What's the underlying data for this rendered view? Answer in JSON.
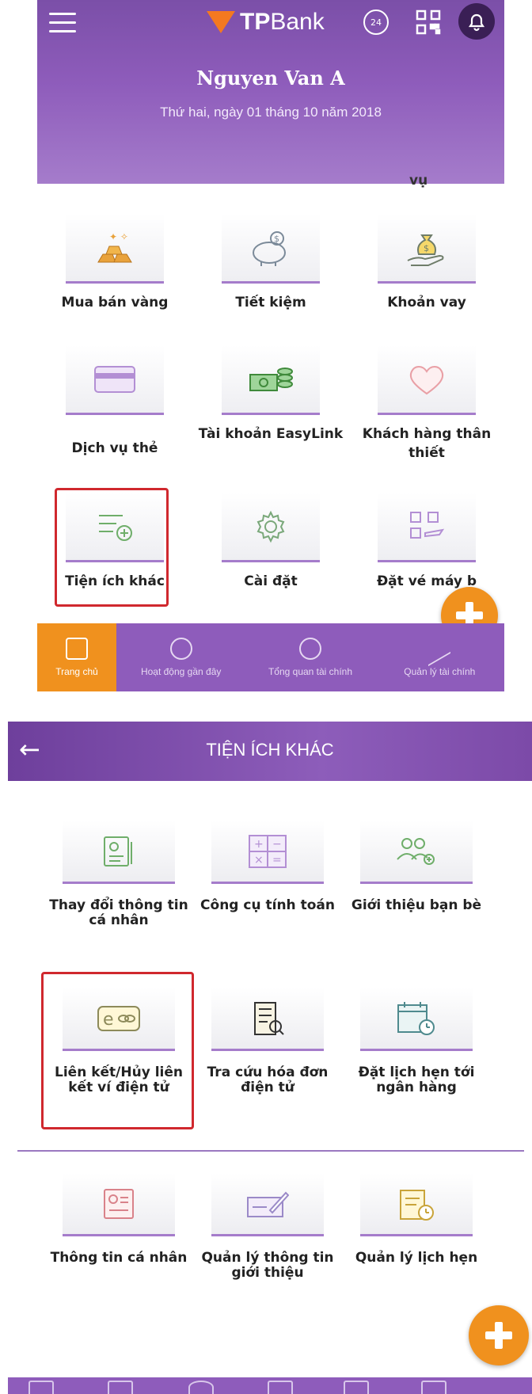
{
  "screen1": {
    "header": {
      "brand_prefix": "TP",
      "brand_suffix": "Bank",
      "user_name": "Nguyen Van A",
      "date": "Thứ hai, ngày 01 tháng 10 năm 2018",
      "hotline_badge": "24"
    },
    "cut_text": "vụ",
    "tiles": [
      {
        "label": "Mua bán vàng",
        "icon": "gold-bars-icon"
      },
      {
        "label": "Tiết kiệm",
        "icon": "piggy-bank-icon"
      },
      {
        "label": "Khoản vay",
        "icon": "money-bag-hand-icon"
      },
      {
        "label": "Dịch vụ thẻ",
        "icon": "card-icon"
      },
      {
        "label": "Tài khoản EasyLink",
        "icon": "coins-banknote-icon"
      },
      {
        "label": "Khách hàng thân thiết",
        "icon": "heart-icon"
      },
      {
        "label": "Tiện ích khác",
        "icon": "list-plus-icon"
      },
      {
        "label": "Cài đặt",
        "icon": "gear-icon"
      },
      {
        "label": "Đặt vé máy b",
        "icon": "plane-qr-icon"
      }
    ],
    "bottom_nav": [
      {
        "label": "Trang chủ",
        "icon": "home-icon"
      },
      {
        "label": "Hoạt động gần đây",
        "icon": "clock-icon"
      },
      {
        "label": "Tổng quan tài chính",
        "icon": "pie-chart-icon"
      },
      {
        "label": "Quản lý tài chính",
        "icon": "trend-icon"
      }
    ]
  },
  "screen2": {
    "title": "TIỆN ÍCH KHÁC",
    "tiles": [
      {
        "label": "Thay đổi thông tin cá nhân",
        "icon": "profile-edit-icon"
      },
      {
        "label": "Công cụ tính toán",
        "icon": "calculator-icon"
      },
      {
        "label": "Giới thiệu bạn bè",
        "icon": "refer-friends-icon"
      },
      {
        "label": "Liên kết/Hủy liên kết ví điện tử",
        "icon": "e-wallet-link-icon"
      },
      {
        "label": "Tra cứu hóa đơn điện tử",
        "icon": "e-invoice-icon"
      },
      {
        "label": "Đặt lịch hẹn tới ngân hàng",
        "icon": "calendar-clock-icon"
      },
      {
        "label": "Thông tin cá nhân",
        "icon": "profile-card-icon"
      },
      {
        "label": "Quản lý thông tin giới thiệu",
        "icon": "referral-edit-icon"
      },
      {
        "label": "Quản lý lịch hẹn",
        "icon": "schedule-clock-icon"
      }
    ]
  },
  "colors": {
    "brand_purple": "#8e5cbb",
    "accent_orange": "#f0911e",
    "highlight_red": "#d0282e"
  }
}
